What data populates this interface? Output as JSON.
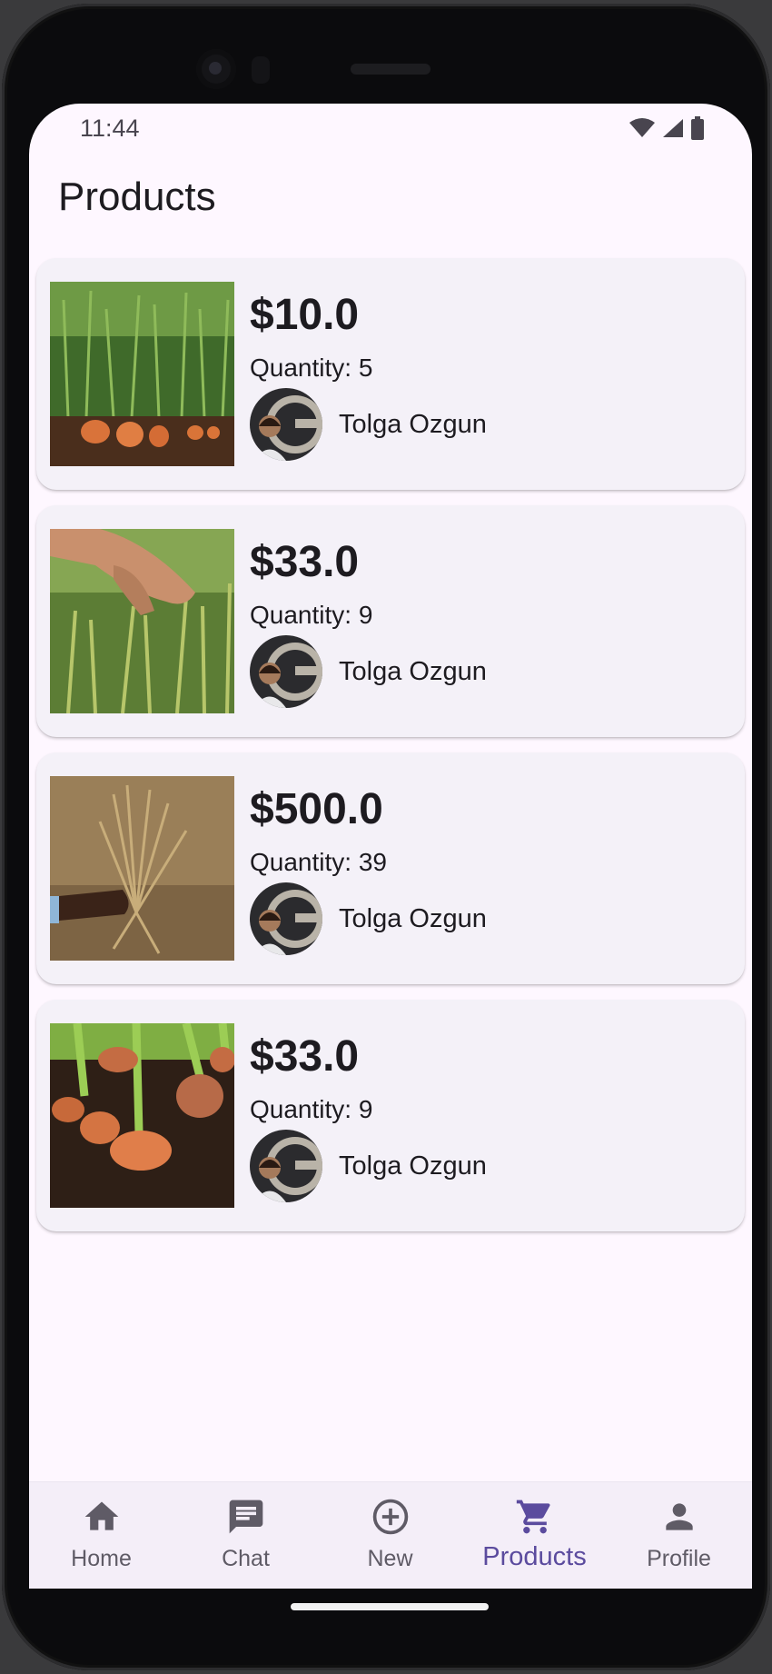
{
  "status_bar": {
    "time": "11:44"
  },
  "page": {
    "title": "Products"
  },
  "products": [
    {
      "price": "$10.0",
      "quantity": "Quantity: 5",
      "seller": "Tolga Ozgun",
      "image": "carrots-in-soil"
    },
    {
      "price": "$33.0",
      "quantity": "Quantity: 9",
      "seller": "Tolga Ozgun",
      "image": "hand-touching-wheat"
    },
    {
      "price": "$500.0",
      "quantity": "Quantity: 39",
      "seller": "Tolga Ozgun",
      "image": "hand-holding-wheat-bundle"
    },
    {
      "price": "$33.0",
      "quantity": "Quantity: 9",
      "seller": "Tolga Ozgun",
      "image": "carrots-closeup"
    }
  ],
  "bottom_nav": {
    "items": [
      {
        "label": "Home",
        "icon": "home-icon"
      },
      {
        "label": "Chat",
        "icon": "chat-icon"
      },
      {
        "label": "New",
        "icon": "add-circle-icon"
      },
      {
        "label": "Products",
        "icon": "cart-icon",
        "active": true
      },
      {
        "label": "Profile",
        "icon": "person-icon"
      }
    ]
  },
  "colors": {
    "background": "#fef7ff",
    "card": "#f4f1f8",
    "accent": "#5b4b9e",
    "text": "#1d1b20"
  }
}
